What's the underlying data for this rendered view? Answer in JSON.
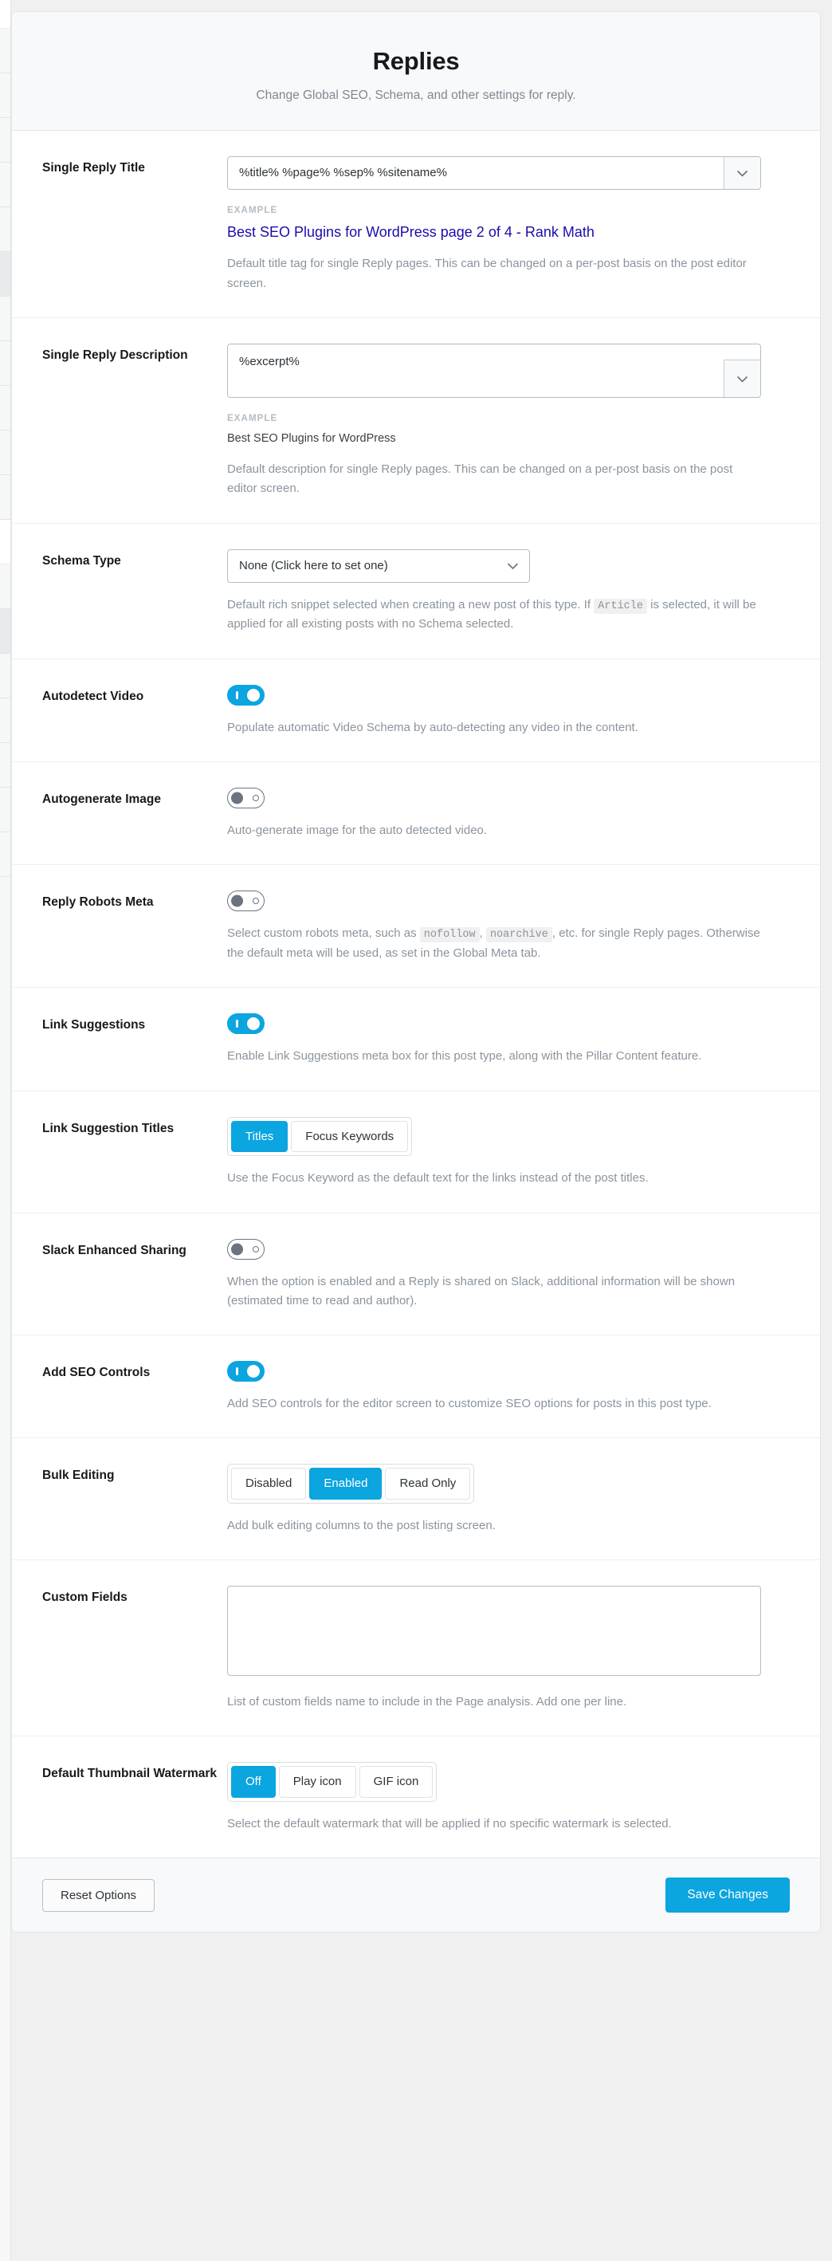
{
  "colors": {
    "accent": "#0ba5e0",
    "link": "#1a0dab",
    "label_text": "#17191b",
    "desc_text": "#8b949d",
    "panel_bg": "#ffffff",
    "header_bg": "#f8f9fa",
    "page_bg": "#f0f0f1",
    "toggle_off_border": "#6b7280"
  },
  "header": {
    "title": "Replies",
    "subtitle": "Change Global SEO, Schema, and other settings for reply."
  },
  "rows": {
    "single_reply_title": {
      "label": "Single Reply Title",
      "value": "%title% %page% %sep% %sitename%",
      "chevron_icon": "chevron-down-icon",
      "example_label": "EXAMPLE",
      "example_title": "Best SEO Plugins for WordPress page 2 of 4 - Rank Math",
      "description": "Default title tag for single Reply pages. This can be changed on a per-post basis on the post editor screen."
    },
    "single_reply_description": {
      "label": "Single Reply Description",
      "value": "%excerpt%",
      "chevron_icon": "chevron-down-icon",
      "example_label": "EXAMPLE",
      "example_text": "Best SEO Plugins for WordPress",
      "description": "Default description for single Reply pages. This can be changed on a per-post basis on the post editor screen."
    },
    "schema_type": {
      "label": "Schema Type",
      "selected": "None (Click here to set one)",
      "chevron_icon": "chevron-down-icon",
      "desc_part1": "Default rich snippet selected when creating a new post of this type. If",
      "desc_code": "Article",
      "desc_part2": "is selected, it will be applied for all existing posts with no Schema selected."
    },
    "autodetect_video": {
      "label": "Autodetect Video",
      "toggle_state": "on",
      "description": "Populate automatic Video Schema by auto-detecting any video in the content."
    },
    "autogenerate_image": {
      "label": "Autogenerate Image",
      "toggle_state": "off",
      "description": "Auto-generate image for the auto detected video."
    },
    "reply_robots_meta": {
      "label": "Reply Robots Meta",
      "toggle_state": "off",
      "desc_part1": "Select custom robots meta, such as",
      "desc_code1": "nofollow",
      "desc_sep": ",",
      "desc_code2": "noarchive",
      "desc_part2": ", etc. for single Reply pages. Otherwise the default meta will be used, as set in the Global Meta tab."
    },
    "link_suggestions": {
      "label": "Link Suggestions",
      "toggle_state": "on",
      "description": "Enable Link Suggestions meta box for this post type, along with the Pillar Content feature."
    },
    "link_suggestion_titles": {
      "label": "Link Suggestion Titles",
      "options": [
        "Titles",
        "Focus Keywords"
      ],
      "selected_index": 0,
      "description": "Use the Focus Keyword as the default text for the links instead of the post titles."
    },
    "slack_enhanced_sharing": {
      "label": "Slack Enhanced Sharing",
      "toggle_state": "off",
      "description": "When the option is enabled and a Reply is shared on Slack, additional information will be shown (estimated time to read and author)."
    },
    "add_seo_controls": {
      "label": "Add SEO Controls",
      "toggle_state": "on",
      "description": "Add SEO controls for the editor screen to customize SEO options for posts in this post type."
    },
    "bulk_editing": {
      "label": "Bulk Editing",
      "options": [
        "Disabled",
        "Enabled",
        "Read Only"
      ],
      "selected_index": 1,
      "description": "Add bulk editing columns to the post listing screen."
    },
    "custom_fields": {
      "label": "Custom Fields",
      "value": "",
      "placeholder": "",
      "description": "List of custom fields name to include in the Page analysis. Add one per line."
    },
    "default_thumbnail_watermark": {
      "label": "Default Thumbnail Watermark",
      "options": [
        "Off",
        "Play icon",
        "GIF icon"
      ],
      "selected_index": 0,
      "description": "Select the default watermark that will be applied if no specific watermark is selected."
    }
  },
  "footer": {
    "reset_label": "Reset Options",
    "save_label": "Save Changes"
  }
}
